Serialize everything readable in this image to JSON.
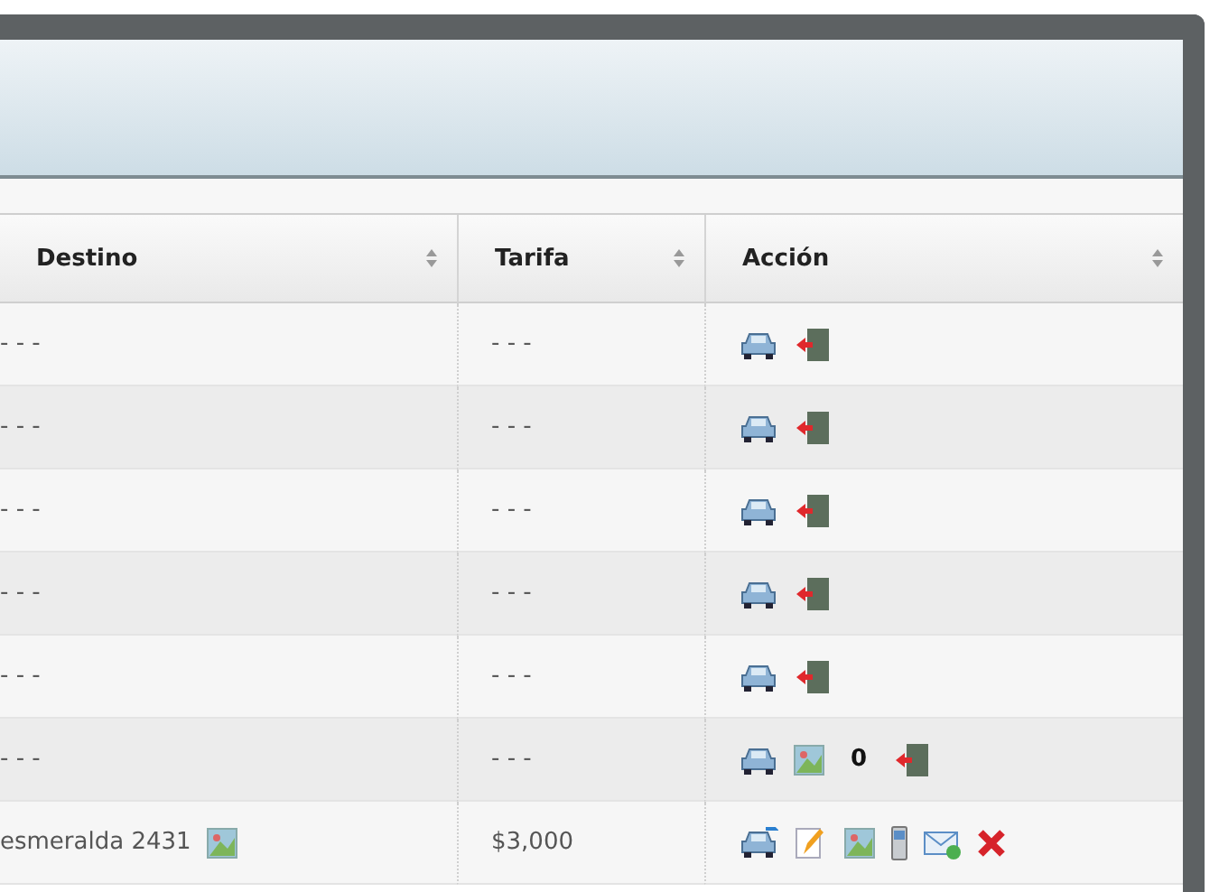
{
  "table": {
    "columns": [
      {
        "label": "Destino"
      },
      {
        "label": "Tarifa"
      },
      {
        "label": "Acción"
      }
    ],
    "rows": [
      {
        "destino": "- - -",
        "tarifa": "- - -",
        "actions": [
          {
            "kind": "car"
          },
          {
            "kind": "exit"
          }
        ]
      },
      {
        "destino": "- - -",
        "tarifa": "- - -",
        "actions": [
          {
            "kind": "car"
          },
          {
            "kind": "exit"
          }
        ]
      },
      {
        "destino": "- - -",
        "tarifa": "- - -",
        "actions": [
          {
            "kind": "car"
          },
          {
            "kind": "exit"
          }
        ]
      },
      {
        "destino": "- - -",
        "tarifa": "- - -",
        "actions": [
          {
            "kind": "car"
          },
          {
            "kind": "exit"
          }
        ]
      },
      {
        "destino": "- - -",
        "tarifa": "- - -",
        "actions": [
          {
            "kind": "car"
          },
          {
            "kind": "exit"
          }
        ]
      },
      {
        "destino": "- - -",
        "tarifa": "- - -",
        "actions": [
          {
            "kind": "car"
          },
          {
            "kind": "image"
          },
          {
            "kind": "count",
            "text": "0"
          },
          {
            "kind": "exit"
          }
        ]
      },
      {
        "destino": "esmeralda 2431",
        "destino_icons": [
          {
            "kind": "image"
          }
        ],
        "tarifa": "$3,000",
        "actions": [
          {
            "kind": "car_send"
          },
          {
            "kind": "edit"
          },
          {
            "kind": "image"
          },
          {
            "kind": "phone"
          },
          {
            "kind": "mail"
          },
          {
            "kind": "delete"
          }
        ]
      }
    ]
  }
}
